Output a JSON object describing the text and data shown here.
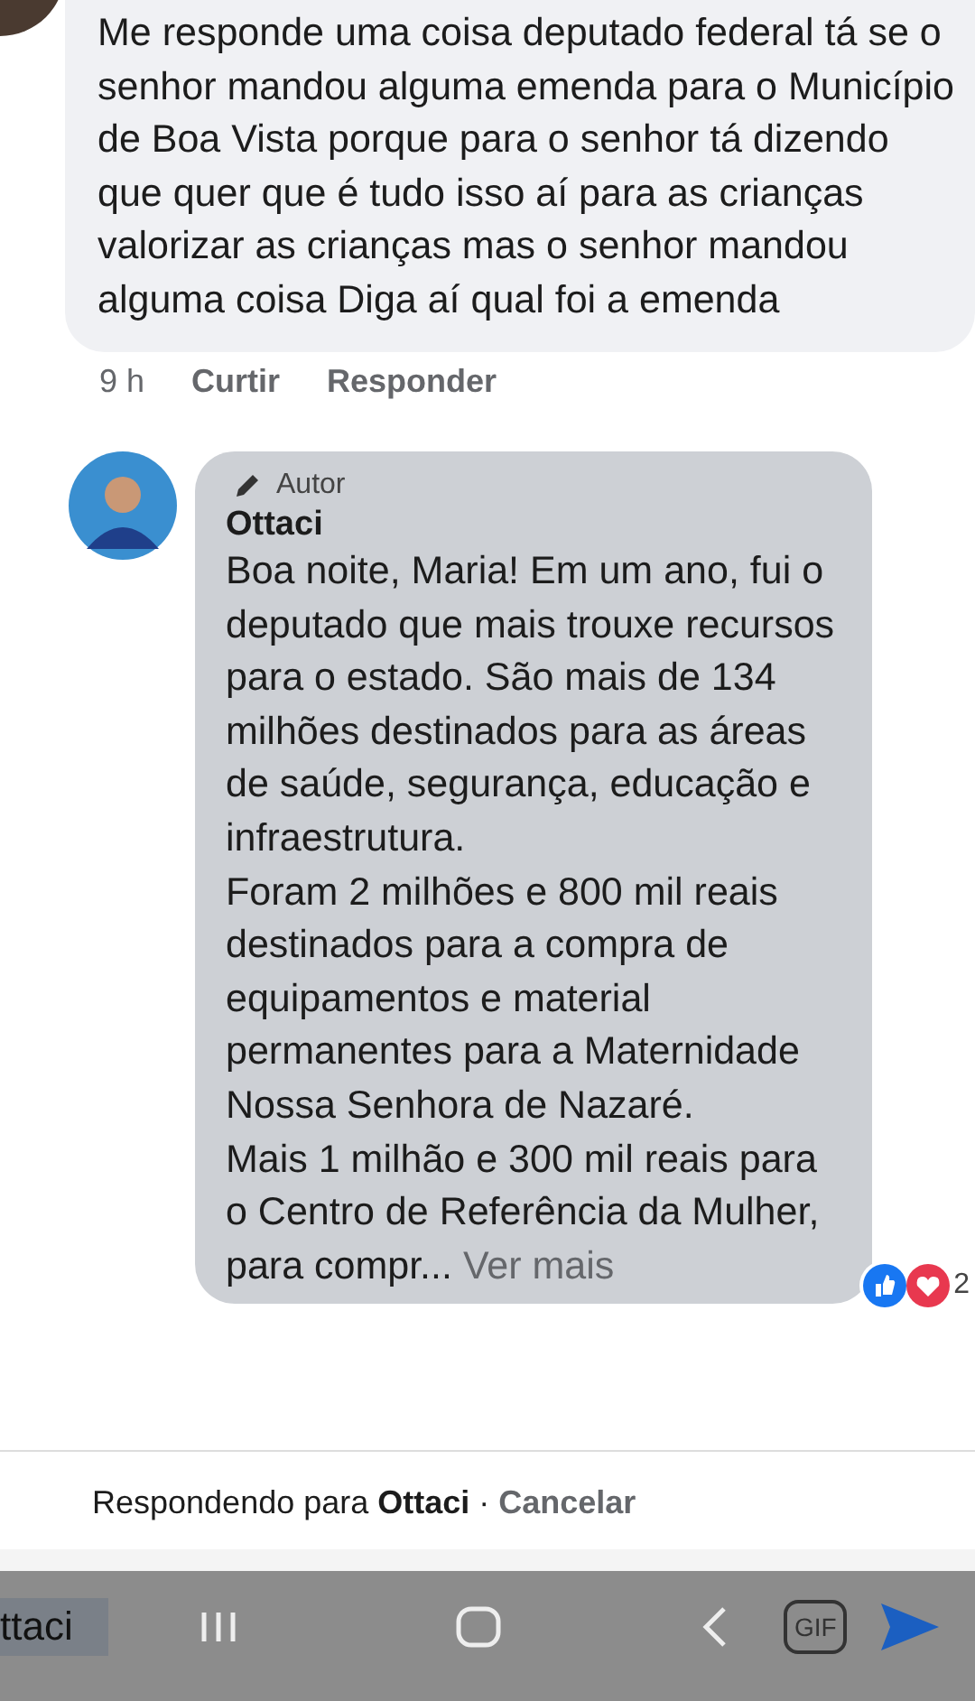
{
  "comments": [
    {
      "kind": "question",
      "text": "Me responde uma coisa deputado federal tá se o senhor mandou alguma emenda para o Município de Boa Vista porque para o senhor tá dizendo que quer que é tudo isso aí para as crianças valorizar as crianças mas o senhor mandou alguma coisa Diga aí qual foi a emenda",
      "time": "9 h",
      "actions": [
        "Curtir",
        "Responder"
      ]
    },
    {
      "kind": "reply",
      "badge": "Autor",
      "author": "Ottaci",
      "paragraphs": [
        "Boa noite, Maria! Em um ano, fui o deputado que mais trouxe recursos para o estado. São mais de 134 milhões destinados para as áreas de saúde, segurança, educação e infraestrutura.",
        "Foram 2 milhões e 800 mil reais destinados para a compra de equipamentos e material permanentes para a Maternidade Nossa Senhora de Nazaré.",
        "Mais 1 milhão e 300 mil reais para o Centro de Referência da Mulher, para compr..."
      ],
      "more": "Ver mais",
      "reaction_count": "2"
    }
  ],
  "reply_bar": {
    "prefix": "Respondendo para",
    "name": "Ottaci",
    "separator": "·",
    "cancel": "Cancelar"
  },
  "composer": {
    "value": "ttaci",
    "gif": "GIF"
  }
}
